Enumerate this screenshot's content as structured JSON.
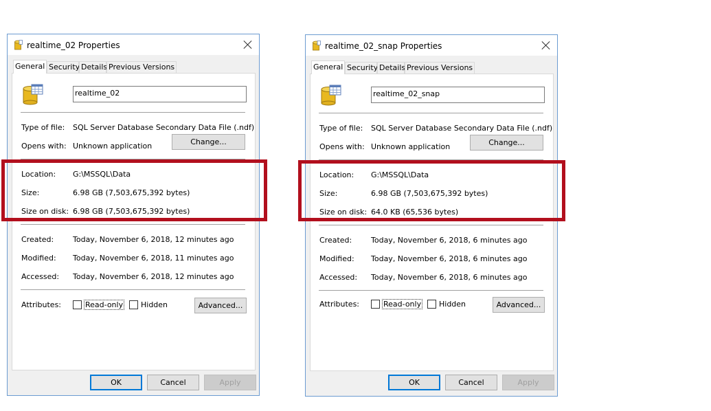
{
  "dialogs": [
    {
      "title": "realtime_02 Properties",
      "tabs": [
        "General",
        "Security",
        "Details",
        "Previous Versions"
      ],
      "name": "realtime_02",
      "type_label": "Type of file:",
      "type_value": "SQL Server Database Secondary Data File (.ndf)",
      "opens_label": "Opens with:",
      "opens_value": "Unknown application",
      "change_button": "Change...",
      "location_label": "Location:",
      "location_value": "G:\\MSSQL\\Data",
      "size_label": "Size:",
      "size_value": "6.98 GB (7,503,675,392 bytes)",
      "disk_label": "Size on disk:",
      "disk_value": "6.98 GB (7,503,675,392 bytes)",
      "created_label": "Created:",
      "created_value": "Today, November 6, 2018, 12 minutes ago",
      "modified_label": "Modified:",
      "modified_value": "Today, November 6, 2018, 11 minutes ago",
      "accessed_label": "Accessed:",
      "accessed_value": "Today, November 6, 2018, 12 minutes ago",
      "attributes_label": "Attributes:",
      "readonly_label": "Read-only",
      "hidden_label": "Hidden",
      "advanced_button": "Advanced...",
      "ok_button": "OK",
      "cancel_button": "Cancel",
      "apply_button": "Apply"
    },
    {
      "title": "realtime_02_snap Properties",
      "tabs": [
        "General",
        "Security",
        "Details",
        "Previous Versions"
      ],
      "name": "realtime_02_snap",
      "type_label": "Type of file:",
      "type_value": "SQL Server Database Secondary Data File (.ndf)",
      "opens_label": "Opens with:",
      "opens_value": "Unknown application",
      "change_button": "Change...",
      "location_label": "Location:",
      "location_value": "G:\\MSSQL\\Data",
      "size_label": "Size:",
      "size_value": "6.98 GB (7,503,675,392 bytes)",
      "disk_label": "Size on disk:",
      "disk_value": "64.0 KB (65,536 bytes)",
      "created_label": "Created:",
      "created_value": "Today, November 6, 2018, 6 minutes ago",
      "modified_label": "Modified:",
      "modified_value": "Today, November 6, 2018, 6 minutes ago",
      "accessed_label": "Accessed:",
      "accessed_value": "Today, November 6, 2018, 6 minutes ago",
      "attributes_label": "Attributes:",
      "readonly_label": "Read-only",
      "hidden_label": "Hidden",
      "advanced_button": "Advanced...",
      "ok_button": "OK",
      "cancel_button": "Cancel",
      "apply_button": "Apply"
    }
  ],
  "colors": {
    "highlight": "#b20f1d",
    "dialog_border": "#6b9bd1",
    "dialog_bg": "#f0f0f0"
  },
  "icons": {
    "title": "database-file-icon",
    "file": "database-file-icon",
    "close": "close-icon"
  }
}
